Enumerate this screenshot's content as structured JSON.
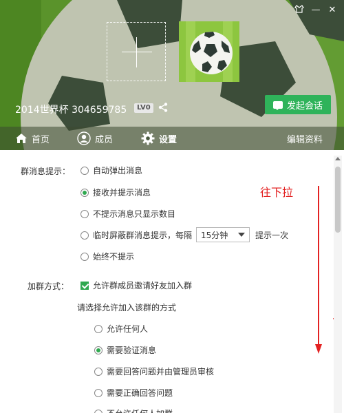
{
  "window": {
    "controls": {
      "skin_icon": "skin-icon",
      "minimize_label": "—",
      "close_label": "✕"
    }
  },
  "header": {
    "group_name": "2014世界杯 304659785",
    "level_badge": "LV0",
    "chat_button_label": "发起会话",
    "colors": {
      "header_green": "#5d9a2c",
      "chat_button": "#2fb35a"
    }
  },
  "tabs": [
    {
      "label": "首页",
      "icon": "home-icon",
      "active": false
    },
    {
      "label": "成员",
      "icon": "member-icon",
      "active": false
    },
    {
      "label": "设置",
      "icon": "gear-icon",
      "active": true
    },
    {
      "label": "编辑资料",
      "icon": "",
      "active": false
    }
  ],
  "settings": {
    "notify_label": "群消息提示：",
    "notify_options": [
      {
        "label": "自动弹出消息",
        "checked": false
      },
      {
        "label": "接收并提示消息",
        "checked": true
      },
      {
        "label": "不提示消息只显示数目",
        "checked": false
      },
      {
        "label": "临时屏蔽群消息提示，每隔",
        "checked": false
      },
      {
        "label": "始终不提示",
        "checked": false
      }
    ],
    "interval_value": "15分钟",
    "interval_suffix": "提示一次",
    "join_label": "加群方式：",
    "allow_invite_label": "允许群成员邀请好友加入群",
    "allow_invite_checked": true,
    "join_prompt": "请选择允许加入该群的方式",
    "join_options": [
      {
        "label": "允许任何人",
        "checked": false
      },
      {
        "label": "需要验证消息",
        "checked": true
      },
      {
        "label": "需要回答问题并由管理员审核",
        "checked": false
      },
      {
        "label": "需要正确回答问题",
        "checked": false
      },
      {
        "label": "不允许任何人加群",
        "checked": false
      }
    ],
    "colors": {
      "radio_checked": "#2fa84f"
    }
  },
  "annotation": {
    "text": "往下拉",
    "color": "#e32222"
  }
}
